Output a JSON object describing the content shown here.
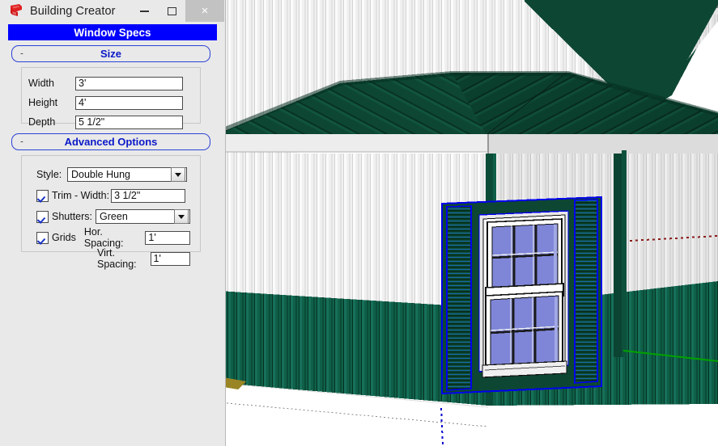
{
  "window": {
    "title": "Building Creator",
    "app_icon": "sketchup-logo-icon",
    "minimize_label": "–",
    "maximize_label": "□",
    "close_label": "×"
  },
  "panel": {
    "header": "Window Specs",
    "sections": [
      {
        "id": "size",
        "title": "Size",
        "collapse_label": "-",
        "fields": [
          {
            "label": "Width",
            "value": "3'"
          },
          {
            "label": "Height",
            "value": "4'"
          },
          {
            "label": "Depth",
            "value": "5 1/2\""
          }
        ]
      },
      {
        "id": "advanced",
        "title": "Advanced Options",
        "collapse_label": "-",
        "style": {
          "label": "Style:",
          "value": "Double Hung"
        },
        "trim": {
          "checked": true,
          "label": "Trim - Width:",
          "value": "3 1/2\""
        },
        "shutters": {
          "checked": true,
          "label": "Shutters:",
          "value": "Green"
        },
        "grids": {
          "checked": true,
          "label": "Grids",
          "hor_label": "Hor. Spacing:",
          "hor_value": "1'",
          "virt_label": "Virt. Spacing:",
          "virt_value": "1'"
        }
      }
    ]
  },
  "viewport": {
    "name": "3d-model-viewport",
    "model": "metal building with double hung window",
    "colors": {
      "roof_green": "#0d4733",
      "roof_green_dark": "#0a3728",
      "siding_white": "#ededed",
      "siding_green": "#0f6048",
      "soffit_gray": "#808080",
      "selection_blue": "#0000ee",
      "glass_blue": "#7f86d8",
      "sash_white": "#f2f2f2",
      "axis_green": "#00a000",
      "axis_red": "#8b1a1a",
      "axis_blue": "#0000cd",
      "trim_tan": "#9a8524"
    },
    "selected_object": "window",
    "axes": [
      "green-axis",
      "red-axis-dotted",
      "blue-axis-dotted"
    ]
  }
}
